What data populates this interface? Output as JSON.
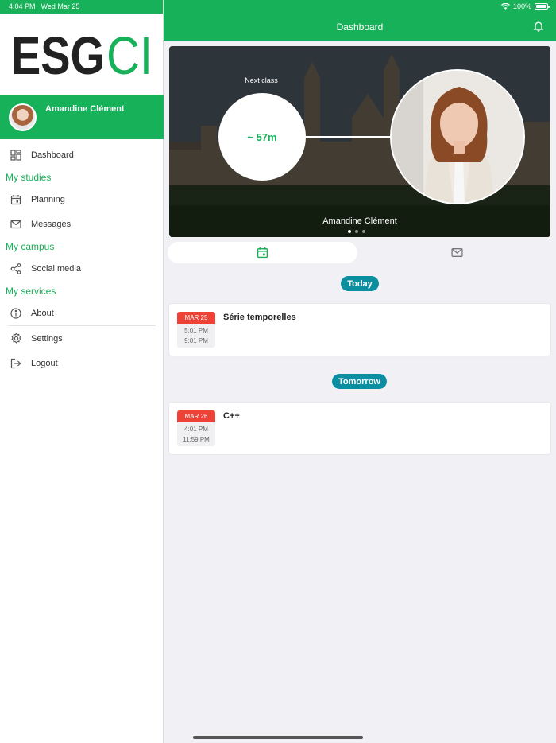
{
  "status_bar": {
    "time": "4:04 PM",
    "date": "Wed Mar 25",
    "battery": "100%"
  },
  "sidebar": {
    "logo": "ESGCI",
    "user_name": "Amandine Clément",
    "items": {
      "dashboard": "Dashboard",
      "section_studies": "My studies",
      "planning": "Planning",
      "messages": "Messages",
      "section_campus": "My campus",
      "social": "Social media",
      "section_services": "My services",
      "about": "About",
      "settings": "Settings",
      "logout": "Logout"
    }
  },
  "header": {
    "title": "Dashboard"
  },
  "hero": {
    "next_label": "Next class",
    "countdown": "~ 57m",
    "name": "Amandine Clément",
    "slides": 3,
    "active_slide": 1
  },
  "colors": {
    "brand_green": "#16b158",
    "teal": "#0b8fa0",
    "date_red": "#ee4236"
  },
  "agenda": [
    {
      "day_label": "Today",
      "date": "MAR 25",
      "start": "5:01 PM",
      "end": "9:01 PM",
      "title": "Série temporelles"
    },
    {
      "day_label": "Tomorrow",
      "date": "MAR 26",
      "start": "4:01 PM",
      "end": "11:59 PM",
      "title": "C++"
    }
  ]
}
